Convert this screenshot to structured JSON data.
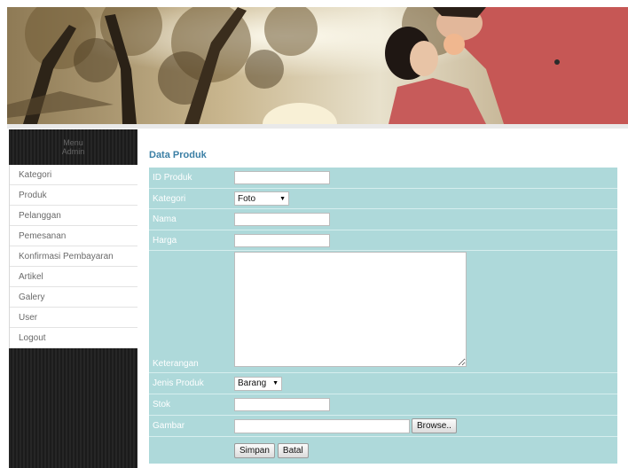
{
  "sidebar": {
    "heading_line1": "Menu",
    "heading_line2": "Admin",
    "items": [
      {
        "label": "Kategori"
      },
      {
        "label": "Produk"
      },
      {
        "label": "Pelanggan"
      },
      {
        "label": "Pemesanan"
      },
      {
        "label": "Konfirmasi Pembayaran"
      },
      {
        "label": "Artikel"
      },
      {
        "label": "Galery"
      },
      {
        "label": "User"
      },
      {
        "label": "Logout"
      }
    ]
  },
  "main": {
    "title": "Data Produk",
    "form": {
      "id_label": "ID Produk",
      "id_value": "",
      "kategori_label": "Kategori",
      "kategori_selected": "Foto",
      "nama_label": "Nama",
      "nama_value": "",
      "harga_label": "Harga",
      "harga_value": "",
      "keterangan_label": "Keterangan",
      "keterangan_value": "",
      "jenis_label": "Jenis Produk",
      "jenis_selected": "Barang",
      "stok_label": "Stok",
      "stok_value": "",
      "gambar_label": "Gambar",
      "gambar_value": "",
      "browse_label": "Browse..",
      "save_label": "Simpan",
      "cancel_label": "Batal"
    }
  },
  "colors": {
    "form_background": "#aed9da",
    "title_color": "#3b7fa5",
    "sidebar_background": "#222222"
  },
  "icons": {
    "dropdown": "chevron-down-icon"
  }
}
